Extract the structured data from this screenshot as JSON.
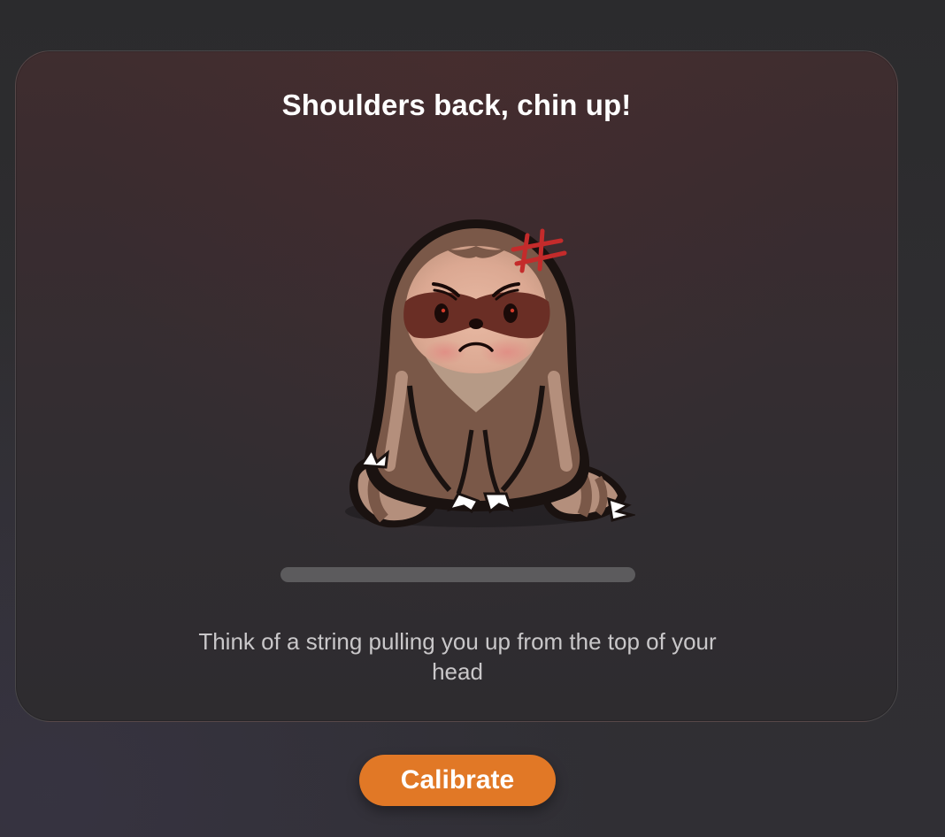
{
  "card": {
    "title": "Shoulders back, chin up!",
    "progress": 0,
    "tip": "Think of a string pulling you up from the top of your head"
  },
  "actions": {
    "calibrate_label": "Calibrate"
  },
  "colors": {
    "accent": "#e17826",
    "progress_track": "#5c5b5d",
    "anger_mark": "#c42b2b"
  },
  "icons": {
    "mascot": "grumpy-sloth-illustration"
  }
}
